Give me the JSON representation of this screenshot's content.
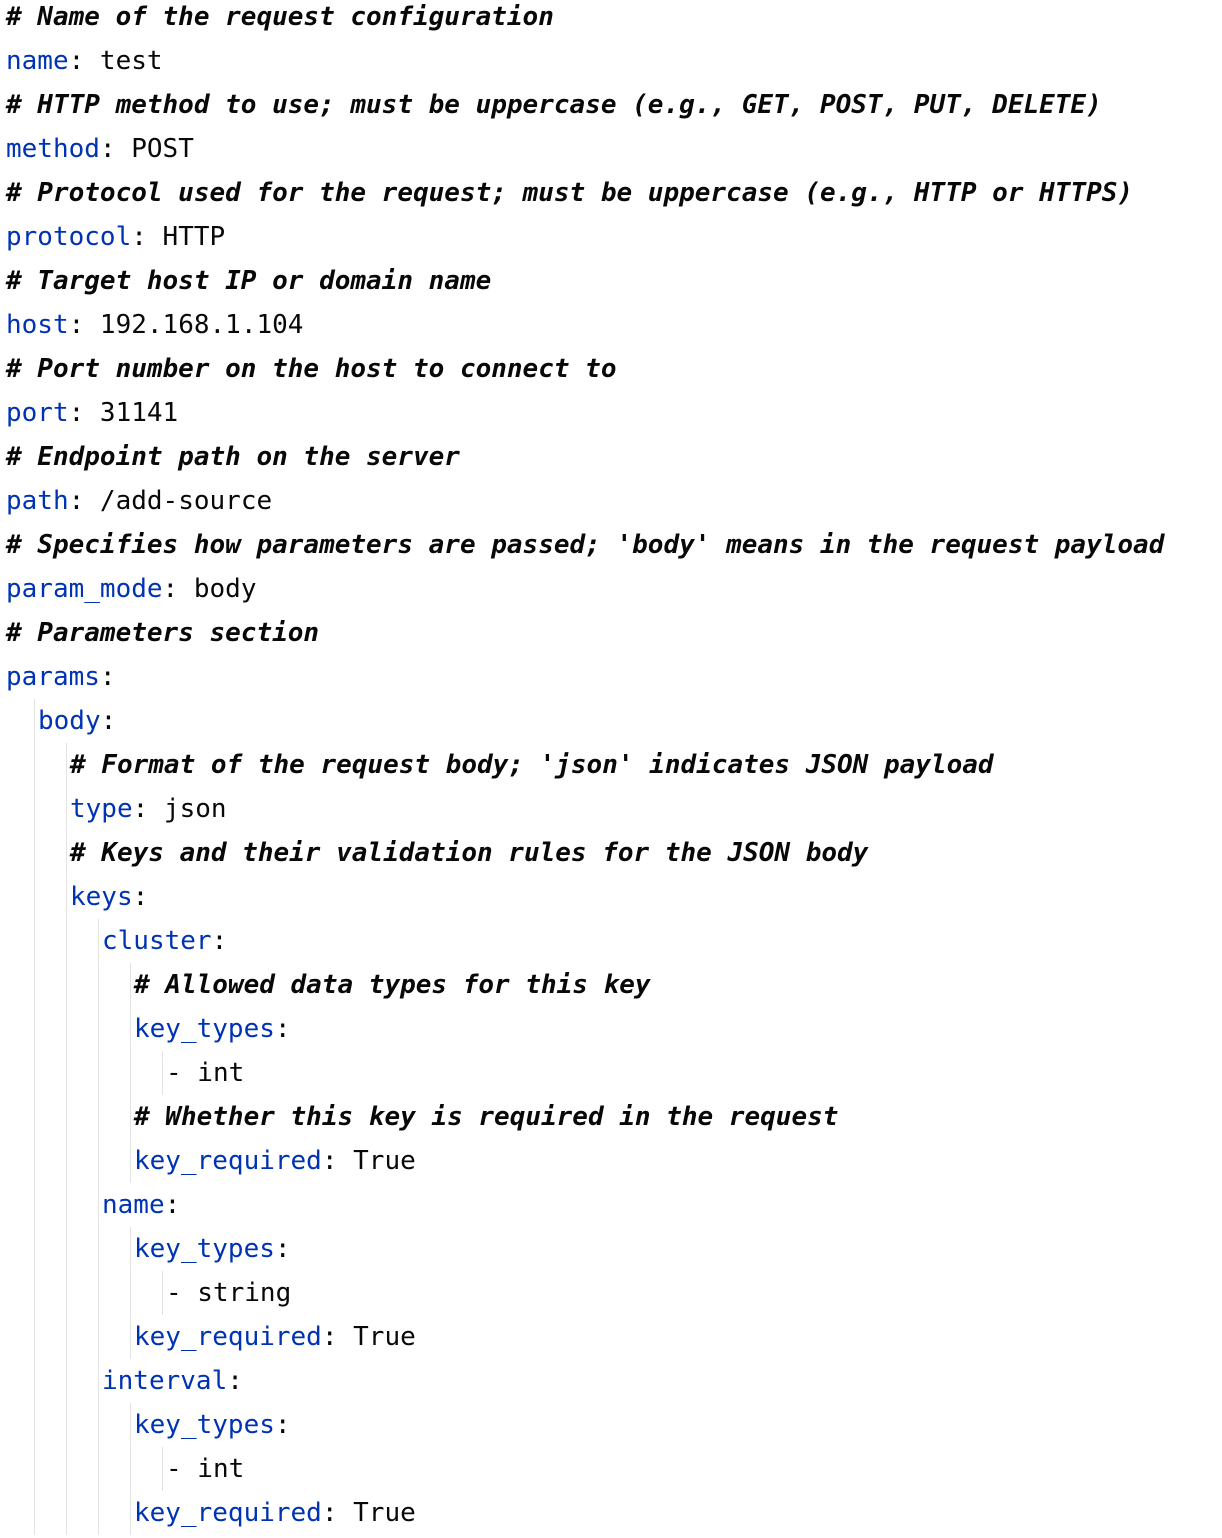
{
  "lines": [
    {
      "kind": "comment",
      "indent": 0,
      "text": "# Name of the request configuration"
    },
    {
      "kind": "pair",
      "indent": 0,
      "key": "name",
      "sep": ":",
      "value": " test"
    },
    {
      "kind": "comment",
      "indent": 0,
      "text": "# HTTP method to use; must be uppercase (e.g., GET, POST, PUT, DELETE)"
    },
    {
      "kind": "pair",
      "indent": 0,
      "key": "method",
      "sep": ":",
      "value": " POST"
    },
    {
      "kind": "comment",
      "indent": 0,
      "text": "# Protocol used for the request; must be uppercase (e.g., HTTP or HTTPS)"
    },
    {
      "kind": "pair",
      "indent": 0,
      "key": "protocol",
      "sep": ":",
      "value": " HTTP"
    },
    {
      "kind": "comment",
      "indent": 0,
      "text": "# Target host IP or domain name"
    },
    {
      "kind": "pair",
      "indent": 0,
      "key": "host",
      "sep": ":",
      "value": " 192.168.1.104"
    },
    {
      "kind": "comment",
      "indent": 0,
      "text": "# Port number on the host to connect to"
    },
    {
      "kind": "pair",
      "indent": 0,
      "key": "port",
      "sep": ":",
      "value": " 31141"
    },
    {
      "kind": "comment",
      "indent": 0,
      "text": "# Endpoint path on the server"
    },
    {
      "kind": "pair",
      "indent": 0,
      "key": "path",
      "sep": ":",
      "value": " /add-source"
    },
    {
      "kind": "comment",
      "indent": 0,
      "text": "# Specifies how parameters are passed; 'body' means in the request payload"
    },
    {
      "kind": "pair",
      "indent": 0,
      "key": "param_mode",
      "sep": ":",
      "value": " body"
    },
    {
      "kind": "comment",
      "indent": 0,
      "text": "# Parameters section"
    },
    {
      "kind": "pair",
      "indent": 0,
      "key": "params",
      "sep": ":",
      "value": ""
    },
    {
      "kind": "pair",
      "indent": 1,
      "key": "body",
      "sep": ":",
      "value": ""
    },
    {
      "kind": "comment",
      "indent": 2,
      "text": "# Format of the request body; 'json' indicates JSON payload"
    },
    {
      "kind": "pair",
      "indent": 2,
      "key": "type",
      "sep": ":",
      "value": " json"
    },
    {
      "kind": "comment",
      "indent": 2,
      "text": "# Keys and their validation rules for the JSON body"
    },
    {
      "kind": "pair",
      "indent": 2,
      "key": "keys",
      "sep": ":",
      "value": ""
    },
    {
      "kind": "pair",
      "indent": 3,
      "key": "cluster",
      "sep": ":",
      "value": ""
    },
    {
      "kind": "comment",
      "indent": 4,
      "text": "# Allowed data types for this key"
    },
    {
      "kind": "pair",
      "indent": 4,
      "key": "key_types",
      "sep": ":",
      "value": ""
    },
    {
      "kind": "item",
      "indent": 5,
      "text": "- int"
    },
    {
      "kind": "comment",
      "indent": 4,
      "text": "# Whether this key is required in the request"
    },
    {
      "kind": "pair",
      "indent": 4,
      "key": "key_required",
      "sep": ":",
      "value": " True"
    },
    {
      "kind": "pair",
      "indent": 3,
      "key": "name",
      "sep": ":",
      "value": ""
    },
    {
      "kind": "pair",
      "indent": 4,
      "key": "key_types",
      "sep": ":",
      "value": ""
    },
    {
      "kind": "item",
      "indent": 5,
      "text": "- string"
    },
    {
      "kind": "pair",
      "indent": 4,
      "key": "key_required",
      "sep": ":",
      "value": " True"
    },
    {
      "kind": "pair",
      "indent": 3,
      "key": "interval",
      "sep": ":",
      "value": ""
    },
    {
      "kind": "pair",
      "indent": 4,
      "key": "key_types",
      "sep": ":",
      "value": ""
    },
    {
      "kind": "item",
      "indent": 5,
      "text": "- int"
    },
    {
      "kind": "pair",
      "indent": 4,
      "key": "key_required",
      "sep": ":",
      "value": " True"
    }
  ]
}
